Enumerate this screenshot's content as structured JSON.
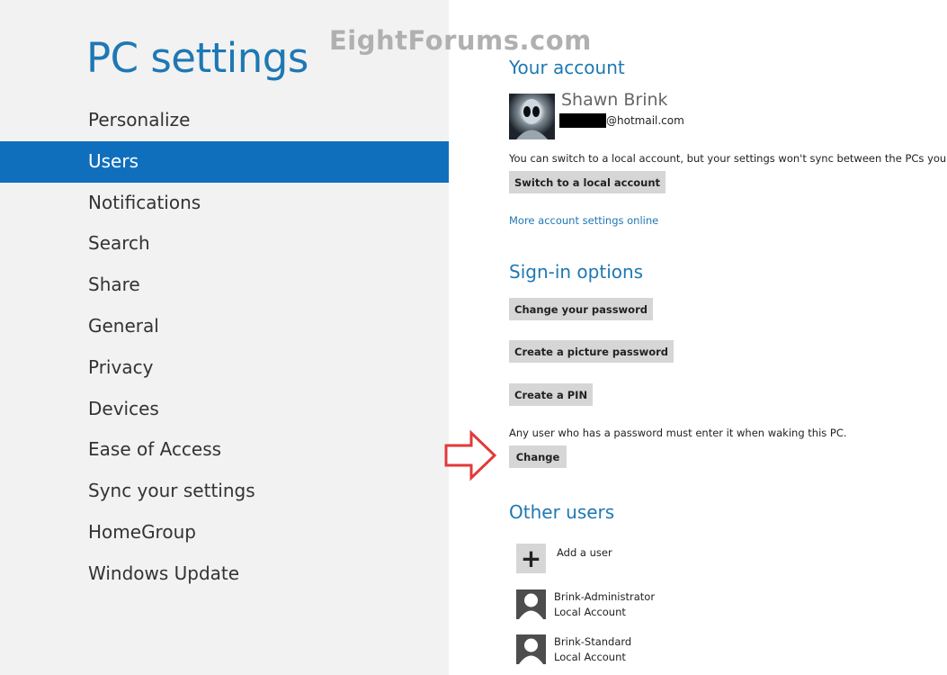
{
  "watermark": "EightForums.com",
  "left": {
    "title": "PC settings",
    "nav": [
      {
        "label": "Personalize",
        "selected": false
      },
      {
        "label": "Users",
        "selected": true
      },
      {
        "label": "Notifications",
        "selected": false
      },
      {
        "label": "Search",
        "selected": false
      },
      {
        "label": "Share",
        "selected": false
      },
      {
        "label": "General",
        "selected": false
      },
      {
        "label": "Privacy",
        "selected": false
      },
      {
        "label": "Devices",
        "selected": false
      },
      {
        "label": "Ease of Access",
        "selected": false
      },
      {
        "label": "Sync your settings",
        "selected": false
      },
      {
        "label": "HomeGroup",
        "selected": false
      },
      {
        "label": "Windows Update",
        "selected": false
      }
    ]
  },
  "account": {
    "heading": "Your account",
    "name": "Shawn Brink",
    "email_suffix": "@hotmail.com",
    "note": "You can switch to a local account, but your settings won't sync between the PCs you use.",
    "switch_button": "Switch to a local account",
    "more_link": "More account settings online"
  },
  "signin": {
    "heading": "Sign-in options",
    "change_password": "Change your password",
    "picture_password": "Create a picture password",
    "create_pin": "Create a PIN",
    "note": "Any user who has a password must enter it when waking this PC.",
    "change_button": "Change"
  },
  "others": {
    "heading": "Other users",
    "add_user": "Add a user",
    "users": [
      {
        "name": "Brink-Administrator",
        "type": "Local Account"
      },
      {
        "name": "Brink-Standard",
        "type": "Local Account"
      }
    ]
  },
  "colors": {
    "accent": "#1e78b4",
    "selected_nav": "#0f6fbd",
    "left_bg": "#f2f2f2",
    "button_bg": "#d6d6d6",
    "arrow": "#e23a3a"
  }
}
